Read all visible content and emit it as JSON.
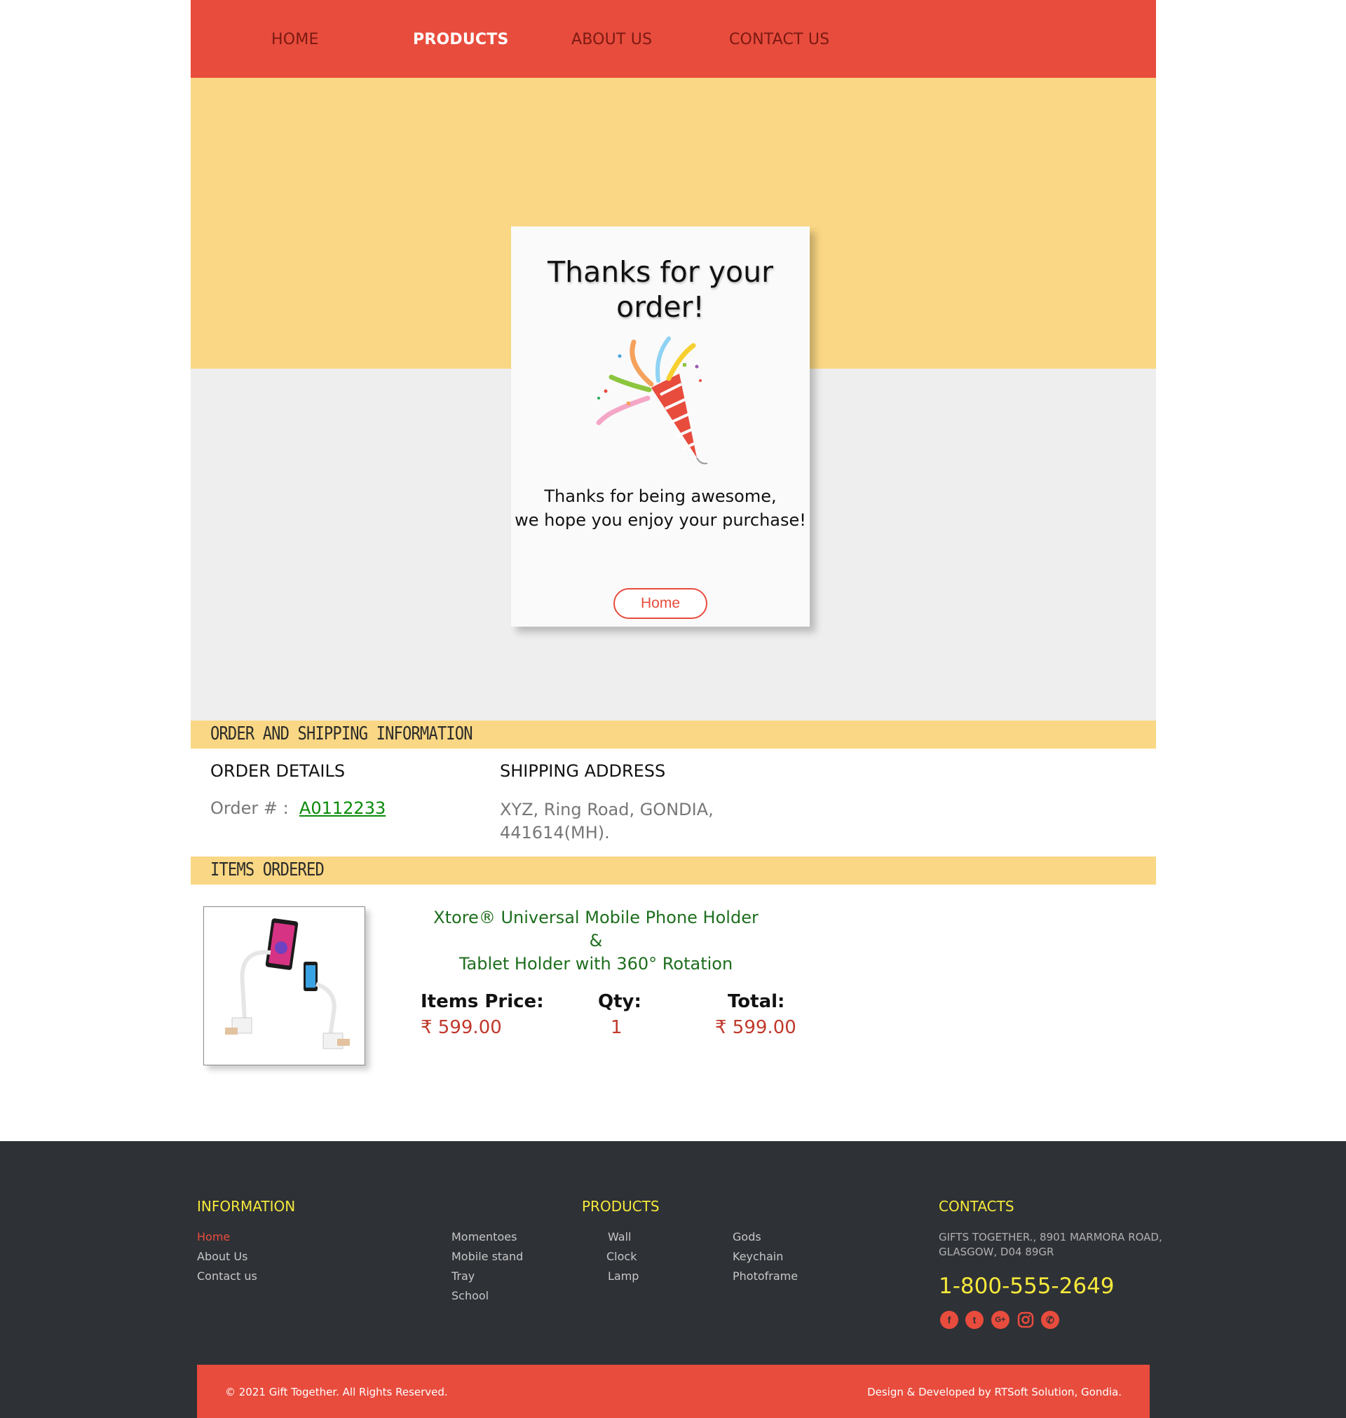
{
  "nav": {
    "home": "HOME",
    "products": "PRODUCTS",
    "about": "ABOUT US",
    "contact": "CONTACT US"
  },
  "card": {
    "title": "Thanks for your order!",
    "message_line1": "Thanks for being awesome,",
    "message_line2": "we hope you enjoy your purchase!",
    "button": "Home",
    "icon": "party-popper-icon"
  },
  "sections": {
    "order_shipping": "ORDER AND SHIPPING INFORMATION",
    "items_ordered": "ITEMS ORDERED"
  },
  "order": {
    "details_heading": "ORDER DETAILS",
    "shipping_heading": "SHIPPING ADDRESS",
    "order_label": "Order # :",
    "order_number": "A0112233",
    "address_line1": "XYZ, Ring Road, GONDIA,",
    "address_line2": "441614(MH)."
  },
  "item": {
    "name_line1": "Xtore® Universal Mobile Phone Holder &",
    "name_line2": "Tablet Holder with 360° Rotation",
    "price_label": "Items Price:",
    "price": "₹ 599.00",
    "qty_label": "Qty:",
    "qty": "1",
    "total_label": "Total:",
    "total": "₹ 599.00"
  },
  "footer": {
    "information_heading": "INFORMATION",
    "information_links": [
      "Home",
      "About Us",
      "Contact us"
    ],
    "products_heading": "PRODUCTS",
    "products_col1": [
      "Momentoes",
      "Mobile stand",
      "Tray",
      "School"
    ],
    "products_col2": [
      "Wall",
      "Clock",
      "Lamp"
    ],
    "products_col3": [
      "Gods",
      "Keychain",
      "Photoframe"
    ],
    "contacts_heading": "CONTACTS",
    "address": "GIFTS TOGETHER., 8901 MARMORA ROAD, GLASGOW, D04 89GR",
    "phone": "1-800-555-2649",
    "social_icons": [
      "facebook-icon",
      "twitter-icon",
      "google-plus-icon",
      "instagram-icon",
      "whatsapp-icon"
    ],
    "copyright": "© 2021 Gift Together. All Rights Reserved.",
    "credit": "Design & Developed by RTSoft Solution, Gondia."
  },
  "colors": {
    "primary_red": "#e84c3d",
    "accent_yellow": "#fad784",
    "footer_dark": "#2e3136",
    "footer_heading": "#f5e83c",
    "price_red": "#c0392b",
    "product_green": "#1e6e1e"
  }
}
